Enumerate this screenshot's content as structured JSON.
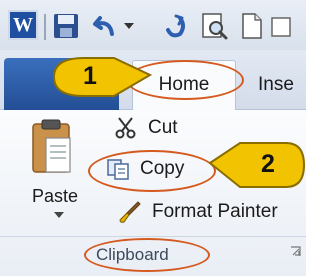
{
  "quick_access": {
    "app_icon_letter": "W",
    "icons": [
      "save-icon",
      "undo-icon",
      "undo-dropdown-icon",
      "redo-icon",
      "print-preview-icon",
      "new-document-icon",
      "more-icon"
    ]
  },
  "tabs": {
    "home": "Home",
    "insert": "Inse"
  },
  "clipboard": {
    "paste": "Paste",
    "cut": "Cut",
    "copy": "Copy",
    "format_painter": "Format Painter",
    "group_label": "Clipboard"
  },
  "callouts": {
    "step1": "1",
    "step2": "2"
  },
  "colors": {
    "highlight_ring": "#d55a1f",
    "callout_fill": "#f2c300",
    "file_tab": "#2b5aa6"
  }
}
